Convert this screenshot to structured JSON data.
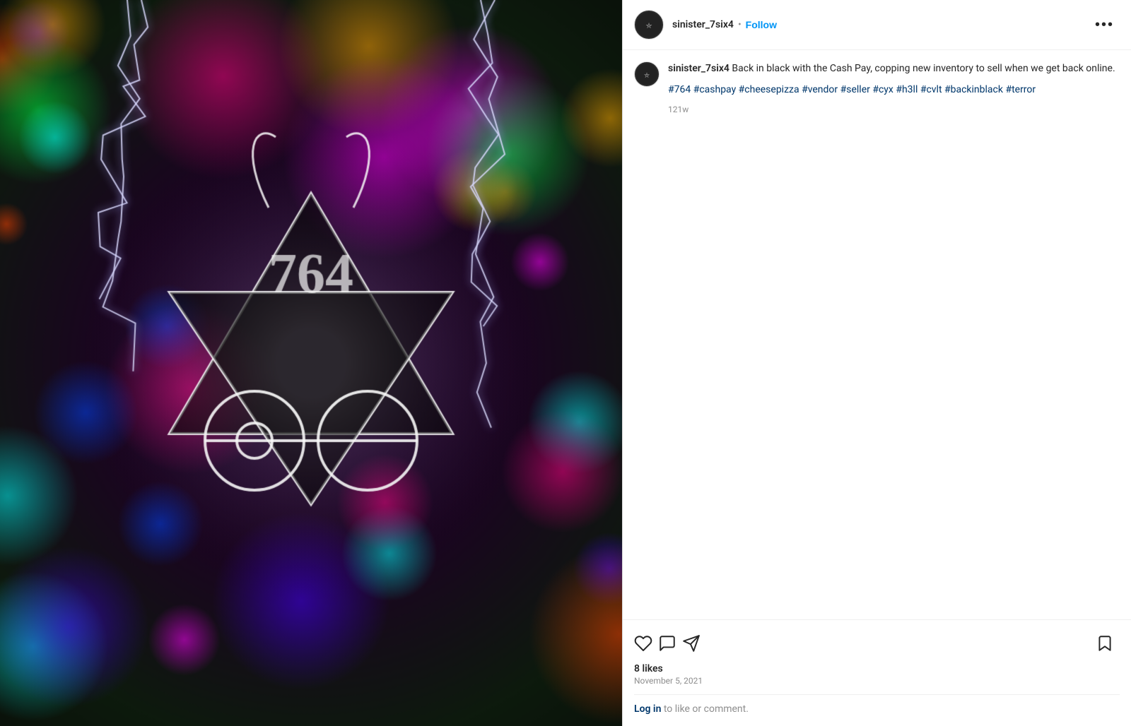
{
  "header": {
    "username": "sinister_7six4",
    "follow_label": "Follow",
    "more_options_label": "•••"
  },
  "caption": {
    "username": "sinister_7six4",
    "body": " Back in black with the Cash Pay, copping new inventory to sell when we get back online.",
    "hashtags": "#764 #cashpay #cheesepizza #vendor #seller #cyx #h3ll #cvlt #backinblack #terror",
    "timestamp": "121w"
  },
  "actions": {
    "like_icon": "heart",
    "comment_icon": "comment",
    "share_icon": "paper-plane",
    "bookmark_icon": "bookmark"
  },
  "engagement": {
    "likes_label": "8 likes",
    "date_label": "November 5, 2021"
  },
  "footer": {
    "login_text": " to like or comment.",
    "login_link": "Log in"
  },
  "colors": {
    "follow_color": "#0095f6",
    "hashtag_color": "#00376b",
    "login_link_color": "#00376b"
  }
}
